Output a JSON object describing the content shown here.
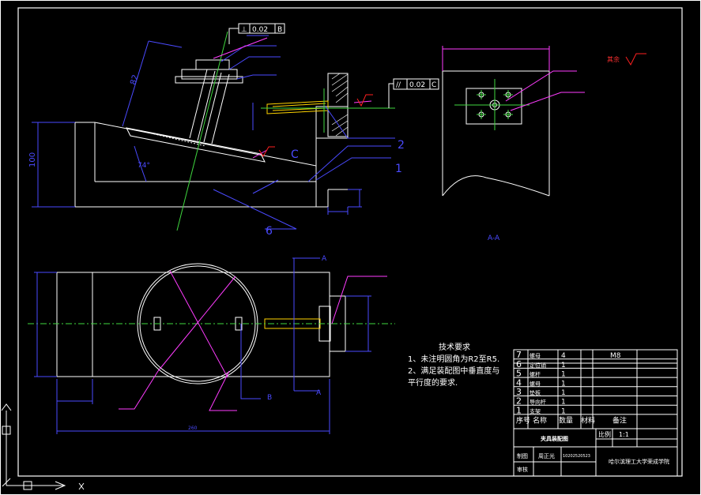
{
  "drawing": {
    "tech_requirements": {
      "heading": "技术要求",
      "line1": "1、未注明圆角为R2至R5.",
      "line2": "2、满足装配图中垂直度与",
      "line3": "平行度的要求."
    },
    "section_label": "A-A",
    "rough_label": "其余",
    "callouts": {
      "c_top": "C",
      "n1": "1",
      "n2": "2",
      "n6": "6",
      "a_top": "A",
      "a_bot": "A",
      "b_bot": "B",
      "angle": "74°"
    },
    "tolerance1": {
      "sym": "⊥",
      "val": "0.02",
      "ref": "B"
    },
    "tolerance2": {
      "sym": "//",
      "val": "0.02",
      "ref": "C"
    },
    "dims": {
      "d100": "100",
      "d82": "82",
      "d260": "260"
    },
    "bom": {
      "rows": [
        {
          "no": "7",
          "name": "螺母",
          "qty": "4",
          "material": "",
          "note": "M8"
        },
        {
          "no": "6",
          "name": "定位销",
          "qty": "1",
          "material": "",
          "note": ""
        },
        {
          "no": "5",
          "name": "螺杆",
          "qty": "1",
          "material": "",
          "note": ""
        },
        {
          "no": "4",
          "name": "螺母",
          "qty": "1",
          "material": "",
          "note": ""
        },
        {
          "no": "3",
          "name": "垫板",
          "qty": "1",
          "material": "",
          "note": ""
        },
        {
          "no": "2",
          "name": "导向杆",
          "qty": "1",
          "material": "",
          "note": ""
        },
        {
          "no": "1",
          "name": "支架",
          "qty": "1",
          "material": "",
          "note": ""
        }
      ],
      "header": {
        "no": "序号",
        "name": "名称",
        "qty": "数量",
        "material": "材料",
        "note": "备注"
      }
    },
    "title_block": {
      "title": "夹具装配图",
      "scale_label": "比例",
      "scale": "1:1",
      "drawn_label": "制图",
      "drawn_by": "周正光",
      "student_no": "10202520523",
      "reviewed_label": "审核",
      "school": "哈尔滨理工大学荣成学院"
    }
  }
}
